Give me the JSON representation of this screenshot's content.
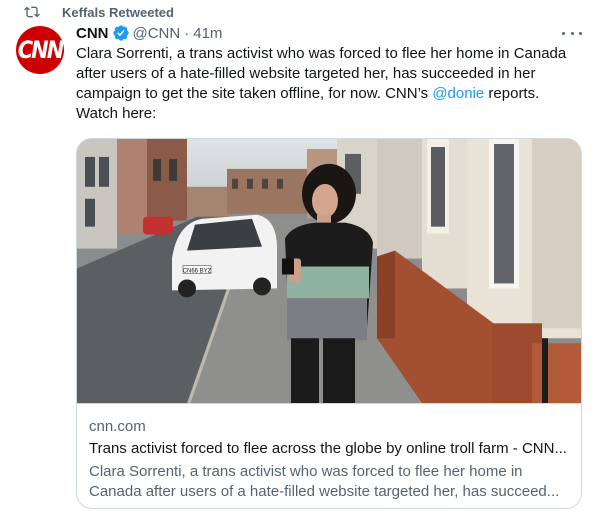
{
  "retweet": {
    "label": "Keffals Retweeted",
    "icon": "retweet-icon"
  },
  "author": {
    "avatar_text": "CNN",
    "avatar_color": "#cc0000",
    "name": "CNN",
    "verified": true,
    "handle": "@CNN",
    "separator": "·",
    "time": "41m"
  },
  "tweet": {
    "text_before": "Clara Sorrenti, a trans activist who was forced to flee her home in Canada after users of a hate-filled website targeted her, has succeeded in her campaign to get the site taken offline, for now. CNN’s ",
    "mention": "@donie",
    "text_after": " reports. Watch here:"
  },
  "card": {
    "domain": "cnn.com",
    "title": "Trans activist forced to flee across the globe by online troll farm - CNN...",
    "description": "Clara Sorrenti, a trans activist who was forced to flee her home in Canada after users of a hate-filled website targeted her, has succeed...",
    "car_plate": "CN66 BYZ"
  },
  "colors": {
    "text_primary": "#0f1419",
    "text_secondary": "#536471",
    "link": "#1d9bf0",
    "border": "#cfd9de"
  }
}
